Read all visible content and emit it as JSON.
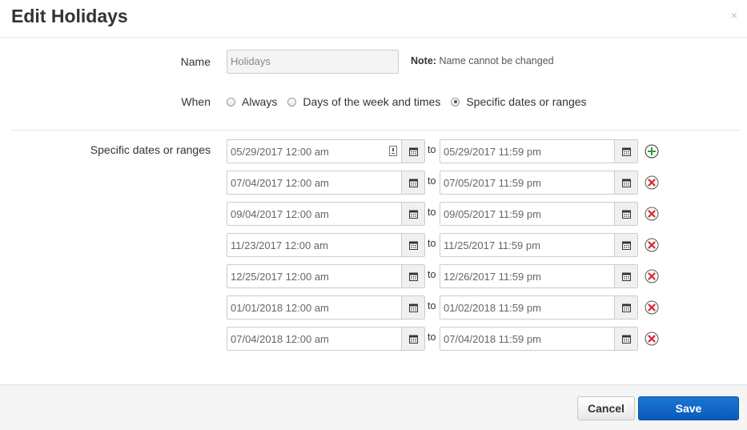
{
  "dialog": {
    "title": "Edit Holidays",
    "close_glyph": "×"
  },
  "name": {
    "label": "Name",
    "value": "Holidays",
    "note_bold": "Note:",
    "note_text": "Name cannot be changed"
  },
  "when": {
    "label": "When",
    "options": [
      {
        "label": "Always",
        "selected": false
      },
      {
        "label": "Days of the week and times",
        "selected": false
      },
      {
        "label": "Specific dates or ranges",
        "selected": true
      }
    ]
  },
  "ranges": {
    "label": "Specific dates or ranges",
    "to_label": "to",
    "items": [
      {
        "start": "05/29/2017 12:00 am",
        "end": "05/29/2017 11:59 pm",
        "action": "add"
      },
      {
        "start": "07/04/2017 12:00 am",
        "end": "07/05/2017 11:59 pm",
        "action": "remove"
      },
      {
        "start": "09/04/2017 12:00 am",
        "end": "09/05/2017 11:59 pm",
        "action": "remove"
      },
      {
        "start": "11/23/2017 12:00 am",
        "end": "11/25/2017 11:59 pm",
        "action": "remove"
      },
      {
        "start": "12/25/2017 12:00 am",
        "end": "12/26/2017 11:59 pm",
        "action": "remove"
      },
      {
        "start": "01/01/2018 12:00 am",
        "end": "01/02/2018 11:59 pm",
        "action": "remove"
      },
      {
        "start": "07/04/2018 12:00 am",
        "end": "07/04/2018 11:59 pm",
        "action": "remove"
      }
    ]
  },
  "footer": {
    "cancel_label": "Cancel",
    "save_label": "Save"
  },
  "colors": {
    "primary": "#0a5bb8",
    "add": "#2e9b2e",
    "remove": "#d9252b"
  }
}
